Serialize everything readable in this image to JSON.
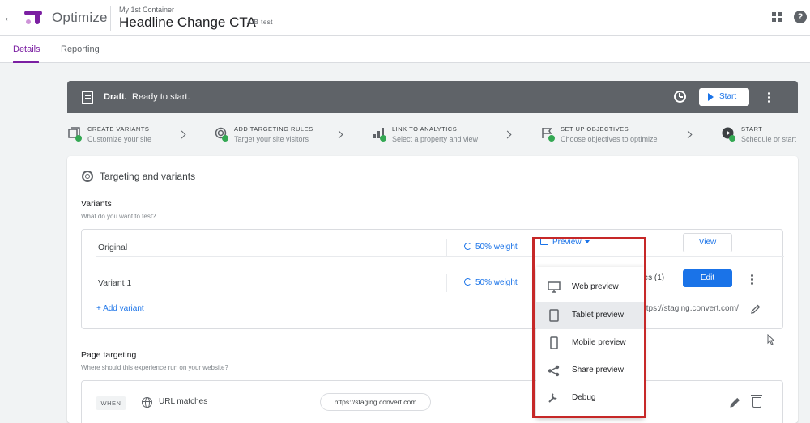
{
  "app": {
    "product_name": "Optimize",
    "container_name": "My 1st Container",
    "experience_name": "Headline Change CTA",
    "experience_type": "A/B test",
    "brand_color": "#7b1fa2",
    "accent_color": "#1a73e8"
  },
  "tabs": [
    {
      "label": "Details",
      "active": true
    },
    {
      "label": "Reporting",
      "active": false
    }
  ],
  "status": {
    "state": "Draft.",
    "message": "Ready to start.",
    "start_label": "Start"
  },
  "steps": [
    {
      "title": "CREATE VARIANTS",
      "subtitle": "Customize your site",
      "icon": "variants-icon",
      "complete": true
    },
    {
      "title": "ADD TARGETING RULES",
      "subtitle": "Target your site visitors",
      "icon": "targeting-icon",
      "complete": true
    },
    {
      "title": "LINK TO ANALYTICS",
      "subtitle": "Select a property and view",
      "icon": "analytics-icon",
      "complete": true
    },
    {
      "title": "SET UP OBJECTIVES",
      "subtitle": "Choose objectives to optimize",
      "icon": "flag-icon",
      "complete": true
    },
    {
      "title": "START",
      "subtitle": "Schedule or start",
      "icon": "play-icon",
      "complete": true
    }
  ],
  "card": {
    "title": "Targeting and variants",
    "variants_title": "Variants",
    "variants_subtitle": "What do you want to test?",
    "variants": [
      {
        "name": "Original",
        "weight": "50% weight",
        "action": "View"
      },
      {
        "name": "Variant 1",
        "weight": "50% weight",
        "action": "Edit",
        "pages": "ges (1)"
      }
    ],
    "preview_label": "Preview",
    "add_variant_label": "+ Add variant",
    "editor_url": "ttps://staging.convert.com/",
    "page_targeting_title": "Page targeting",
    "page_targeting_subtitle": "Where should this experience run on your website?",
    "rule": {
      "when": "WHEN",
      "condition": "URL matches",
      "value": "https://staging.convert.com"
    }
  },
  "preview_menu": [
    {
      "label": "Web preview",
      "icon": "monitor-icon",
      "highlighted": false
    },
    {
      "label": "Tablet preview",
      "icon": "tablet-icon",
      "highlighted": true
    },
    {
      "label": "Mobile preview",
      "icon": "mobile-icon",
      "highlighted": false
    },
    {
      "label": "Share preview",
      "icon": "share-icon",
      "highlighted": false
    },
    {
      "label": "Debug",
      "icon": "wrench-icon",
      "highlighted": false
    }
  ]
}
